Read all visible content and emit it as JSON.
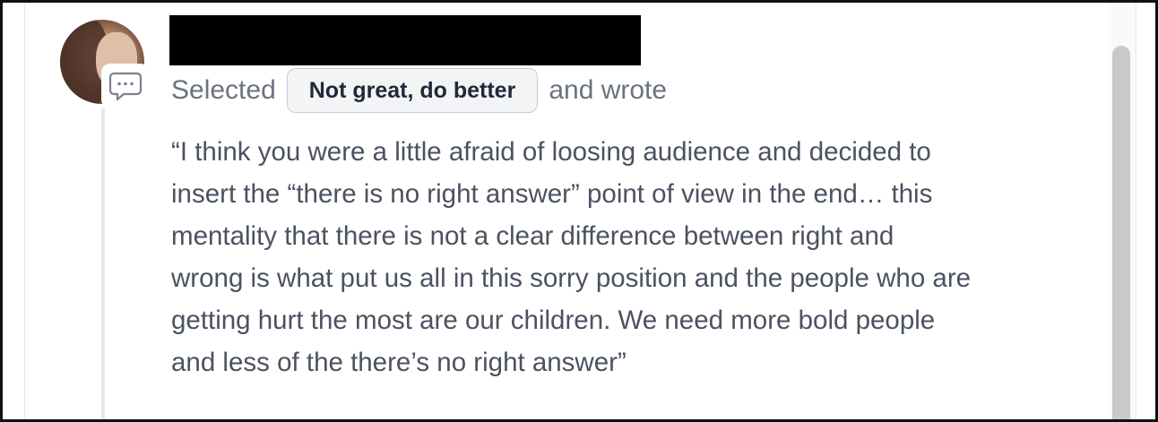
{
  "comment": {
    "author_name": "",
    "avatar_icon": "user-avatar-photo",
    "badge_icon": "speech-bubble-icon",
    "selected_prefix": "Selected",
    "selected_option": "Not great, do better",
    "selected_suffix": "and wrote",
    "quote_text": "“I think you were a little afraid of loosing audience and decided to\ninsert the “there is no right answer” point of view in the end… this\nmentality that there is not a clear difference between right and\nwrong is what put us all in this sorry position and the people who are\ngetting hurt the most are our children. We need more bold people\nand less of the there’s no right answer”"
  },
  "colors": {
    "text_muted": "#6b7280",
    "text_body": "#4b5260",
    "chip_bg": "#f3f4f6",
    "chip_border": "#c7cbd3",
    "redaction": "#000000",
    "scrollbar_thumb": "#c9c9cb"
  }
}
